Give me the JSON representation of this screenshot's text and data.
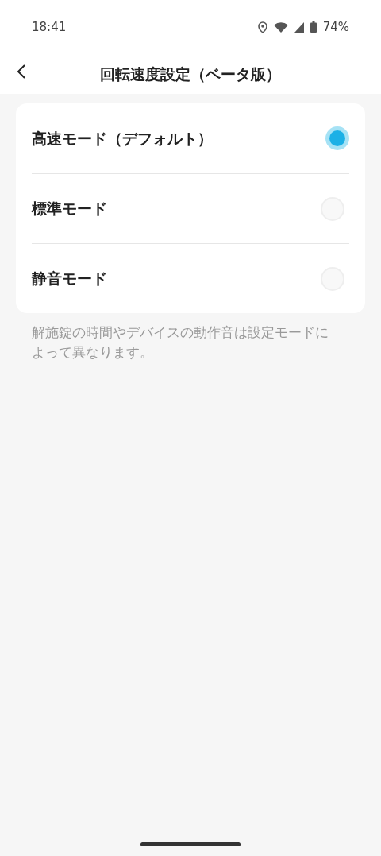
{
  "status_bar": {
    "time": "18:41",
    "battery": "74%"
  },
  "header": {
    "title": "回転速度設定（ベータ版）"
  },
  "options": [
    {
      "label": "高速モード（デフォルト）",
      "selected": true
    },
    {
      "label": "標準モード",
      "selected": false
    },
    {
      "label": "静音モード",
      "selected": false
    }
  ],
  "note": "解施錠の時間やデバイスの動作音は設定モードによって異なります。"
}
